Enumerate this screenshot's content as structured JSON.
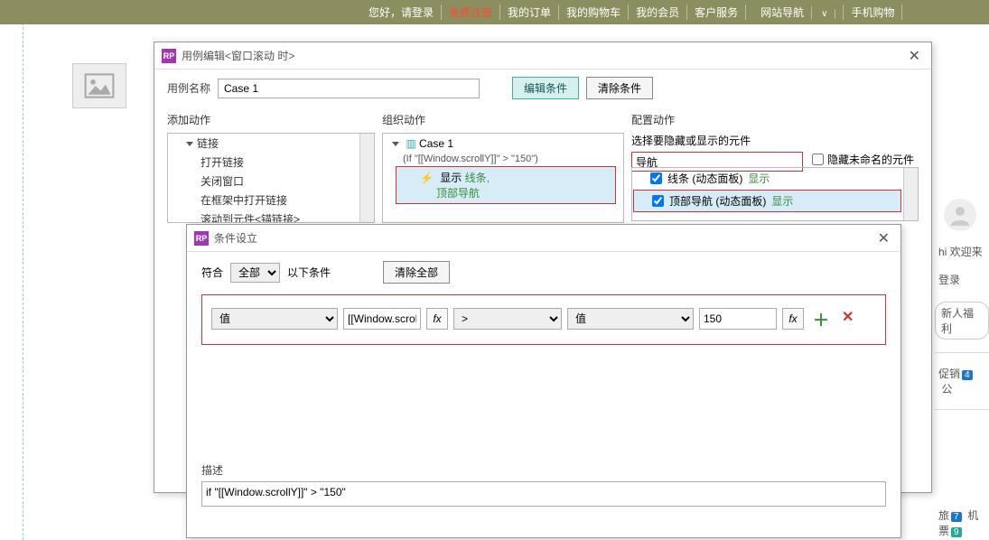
{
  "site_header": {
    "greeting": "您好，请登录",
    "register": "免费注册",
    "orders": "我的订单",
    "cart": "我的购物车",
    "member": "我的会员",
    "service": "客户服务",
    "nav": "网站导航",
    "mobile": "手机购物"
  },
  "right": {
    "hi": "hi 欢迎来",
    "login": "登录",
    "welfare": "新人福利",
    "promo": "促销",
    "badge4": "4",
    "announce": "公",
    "travel": "旅",
    "badge7": "7",
    "flight": "机票",
    "badge9": "9"
  },
  "dialog1": {
    "title": "用例编辑<窗口滚动 时>",
    "name_label": "用例名称",
    "name_value": "Case 1",
    "edit_cond_btn": "编辑条件",
    "clear_cond_btn": "清除条件",
    "col1_title": "添加动作",
    "col2_title": "组织动作",
    "col3_title": "配置动作",
    "tree": {
      "links": "链接",
      "open_link": "打开链接",
      "close_window": "关闭窗口",
      "open_in_frame": "在框架中打开链接",
      "scroll_to": "滚动到元件<锚链接>"
    },
    "case_node": "Case 1",
    "case_cond": "(If \"[[Window.scrollY]]\" > \"150\")",
    "action_show": "显示",
    "action_target1": "线条,",
    "action_target2": "顶部导航",
    "col3_sub": "选择要隐藏或显示的元件",
    "search_value": "导航",
    "hide_unnamed": "隐藏未命名的元件",
    "widget1": "线条 (动态面板)",
    "widget2": "顶部导航 (动态面板)",
    "show_text": "显示"
  },
  "dialog2": {
    "title": "条件设立",
    "match_label": "符合",
    "match_all": "全部",
    "match_suffix": "以下条件",
    "clear_all_btn": "清除全部",
    "row": {
      "type1": "值",
      "expr": "[[Window.scrollY",
      "op": ">",
      "type2": "值",
      "val": "150"
    },
    "desc_label": "描述",
    "desc_value": "if \"[[Window.scrollY]]\" > \"150\""
  }
}
